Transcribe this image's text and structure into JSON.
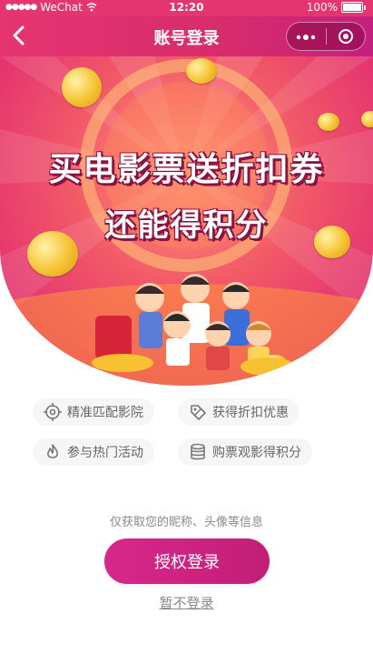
{
  "status_bar": {
    "carrier": "WeChat",
    "time": "12:20",
    "battery": "100%"
  },
  "nav": {
    "title": "账号登录",
    "more_icon": "more-dots-icon",
    "close_icon": "close-circle-icon",
    "back_icon": "chevron-left-icon"
  },
  "banner": {
    "line1": "买电影票送折扣券",
    "line2": "还能得积分"
  },
  "features": [
    {
      "label": "精准匹配影院",
      "icon": "location-target-icon"
    },
    {
      "label": "获得折扣优惠",
      "icon": "tag-icon"
    },
    {
      "label": "参与热门活动",
      "icon": "flame-icon"
    },
    {
      "label": "购票观影得积分",
      "icon": "coin-stack-icon"
    }
  ],
  "auth": {
    "hint": "仅获取您的昵称、头像等信息",
    "login_button": "授权登录",
    "skip_link": "暂不登录"
  },
  "colors": {
    "accent": "#d7288a",
    "nav_bg": "#e43570",
    "banner_center": "#ff9a7a"
  }
}
